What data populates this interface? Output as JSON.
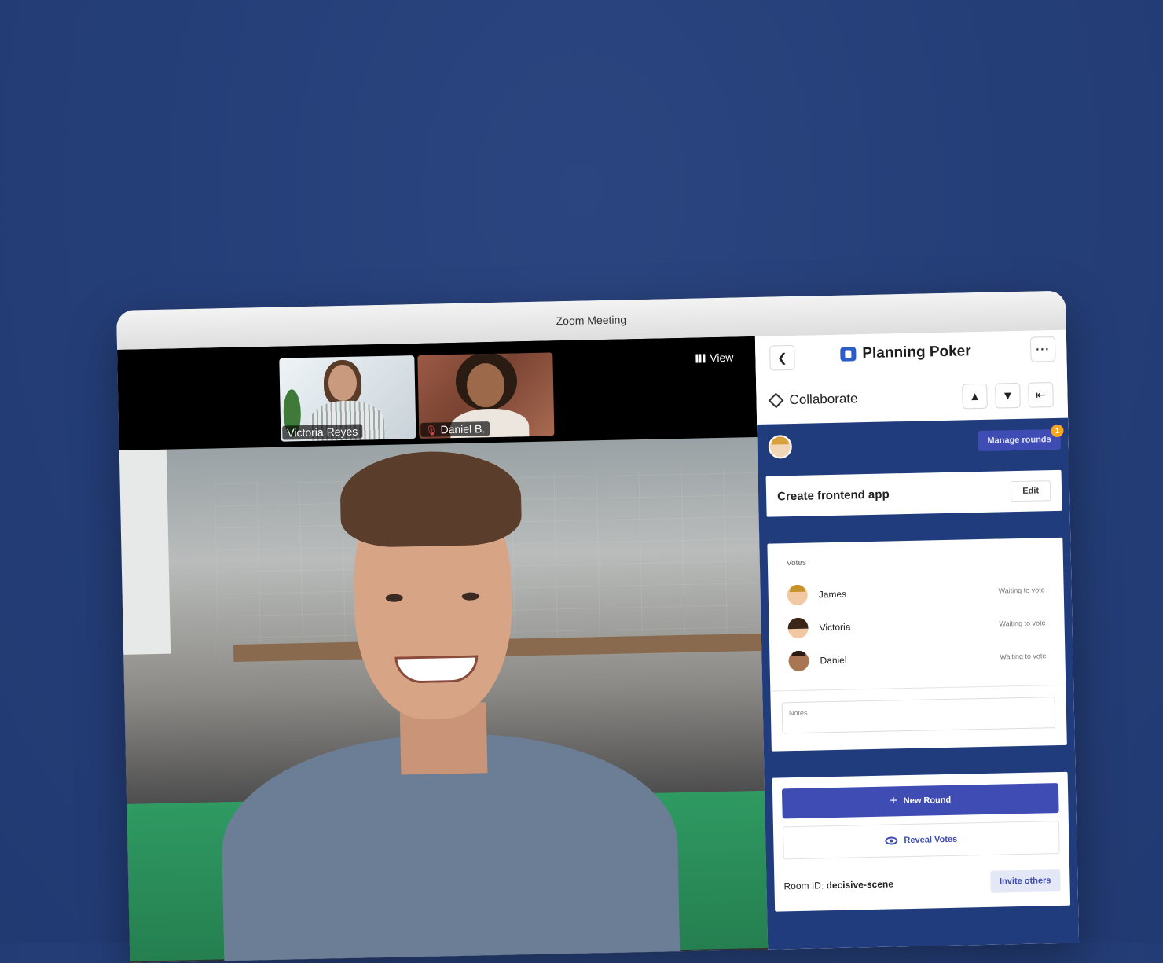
{
  "window": {
    "title": "Zoom Meeting"
  },
  "video": {
    "view_label": "View",
    "thumbnails": [
      {
        "name": "Victoria Reyes",
        "muted": false
      },
      {
        "name": "Daniel B.",
        "muted": true
      }
    ]
  },
  "panel": {
    "app_title": "Planning Poker",
    "section_title": "Collaborate",
    "manage_rounds_label": "Manage rounds",
    "manage_rounds_badge": "1",
    "task": {
      "title": "Create frontend app",
      "edit_label": "Edit"
    },
    "votes": {
      "label": "Votes",
      "items": [
        {
          "name": "James",
          "status": "Waiting to vote"
        },
        {
          "name": "Victoria",
          "status": "Waiting to vote"
        },
        {
          "name": "Daniel",
          "status": "Waiting to vote"
        }
      ]
    },
    "notes_placeholder": "Notes",
    "new_round_label": "New Round",
    "reveal_votes_label": "Reveal Votes",
    "room_label": "Room ID:",
    "room_id": "decisive-scene",
    "invite_label": "Invite others"
  },
  "colors": {
    "background": "#243e78",
    "panel_blue": "#213c7d",
    "accent": "#3e4cb4",
    "badge": "#f6a623"
  }
}
